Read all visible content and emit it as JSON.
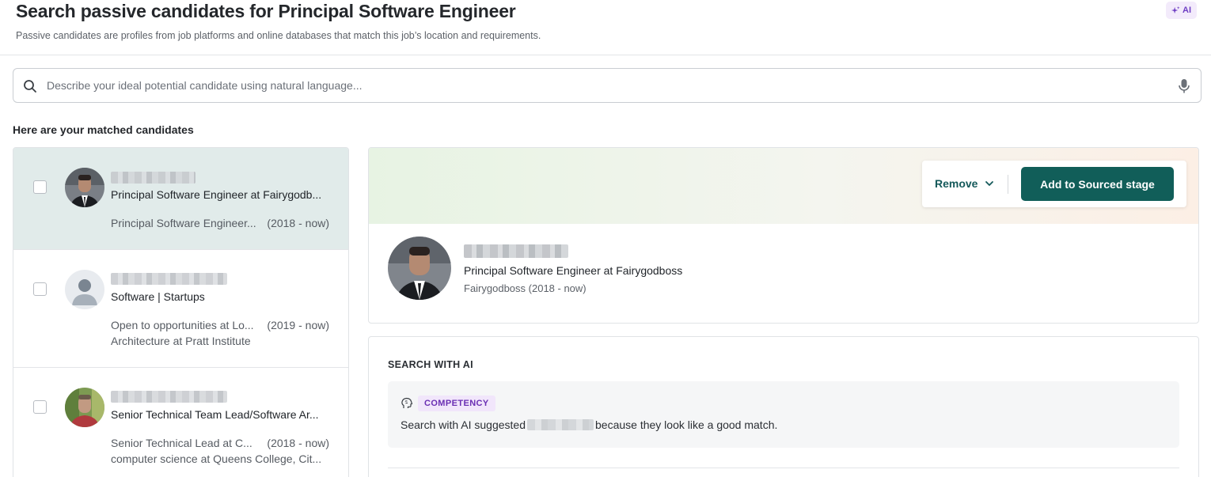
{
  "header": {
    "title": "Search passive candidates for Principal Software Engineer",
    "subtitle": "Passive candidates are profiles from job platforms and online databases that match this job’s location and requirements.",
    "ai_badge": "AI"
  },
  "search": {
    "placeholder": "Describe your ideal potential candidate using natural language...",
    "value": ""
  },
  "section_label": "Here are your matched candidates",
  "candidates": [
    {
      "headline": "Principal Software Engineer at Fairygodb...",
      "meta1_text": "Principal Software Engineer...",
      "meta1_years": "(2018 - now)",
      "meta2_text": "",
      "selected": true
    },
    {
      "headline": "Software | Startups",
      "meta1_text": "Open to opportunities at Lo...",
      "meta1_years": "(2019 - now)",
      "meta2_text": "Architecture at Pratt Institute",
      "selected": false
    },
    {
      "headline": "Senior Technical Team Lead/Software Ar...",
      "meta1_text": "Senior Technical Lead at C...",
      "meta1_years": "(2018 - now)",
      "meta2_text": "computer science at Queens College, Cit...",
      "selected": false
    }
  ],
  "detail": {
    "remove_label": "Remove",
    "add_label": "Add to Sourced stage",
    "headline": "Principal Software Engineer at Fairygodboss",
    "company": "Fairygodboss (2018 - now)"
  },
  "ai_card": {
    "title": "SEARCH WITH AI",
    "tag": "COMPETENCY",
    "reason_before": "Search with AI suggested",
    "reason_after": "because they look like a good match."
  },
  "colors": {
    "primary": "#115e59",
    "selected_row": "#e1ebea",
    "ai_purple": "#6a2fb3"
  }
}
